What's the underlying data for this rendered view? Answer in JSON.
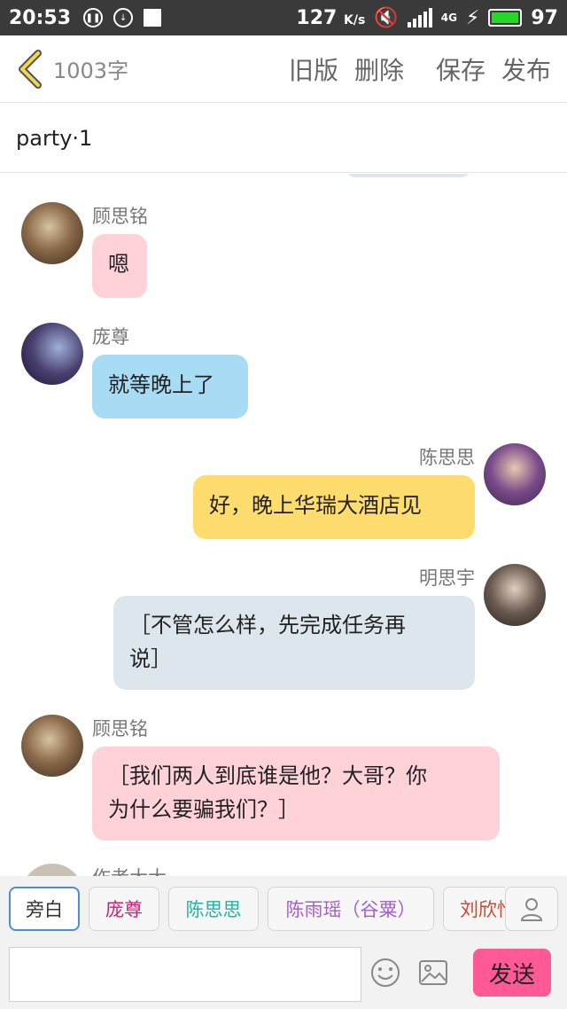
{
  "status_bar": {
    "time": "20:53",
    "net_speed": "127",
    "net_unit": "K/s",
    "network": "4G",
    "battery": "97"
  },
  "header": {
    "word_count": "1003字",
    "old_version": "旧版",
    "delete": "删除",
    "save": "保存",
    "publish": "发布"
  },
  "title": "party·1",
  "messages": [
    {
      "name": "顾思铭",
      "text": "嗯",
      "side": "left",
      "color": "#ffd2da"
    },
    {
      "name": "庞尊",
      "text": "就等晚上了",
      "side": "left",
      "color": "#a8dcf5"
    },
    {
      "name": "陈思思",
      "text": "好，晚上华瑞大酒店见",
      "side": "right",
      "color": "#ffdc6e"
    },
    {
      "name": "明思宇",
      "text_line1": "［不管怎么样，先完成任务再",
      "text_line2": "说］",
      "side": "right",
      "color": "#dce6ec"
    },
    {
      "name": "顾思铭",
      "text_line1": "［我们两人到底谁是他？大哥？你",
      "text_line2": "为什么要骗我们？］",
      "side": "left",
      "color": "#ffd2da"
    },
    {
      "name": "作者大大",
      "side": "left"
    }
  ],
  "characters": [
    {
      "label": "旁白",
      "color": "#333333",
      "active": true
    },
    {
      "label": "庞尊",
      "color": "#c0267a"
    },
    {
      "label": "陈思思",
      "color": "#1fb5a4"
    },
    {
      "label": "陈雨瑶（谷粟）",
      "color": "#a45fc8"
    },
    {
      "label": "刘欣怡",
      "color": "#d0462e"
    }
  ],
  "input": {
    "value": "",
    "send_label": "发送"
  },
  "colors": {
    "accent": "#ff5a96",
    "chip_active": "#4a8ed8"
  }
}
